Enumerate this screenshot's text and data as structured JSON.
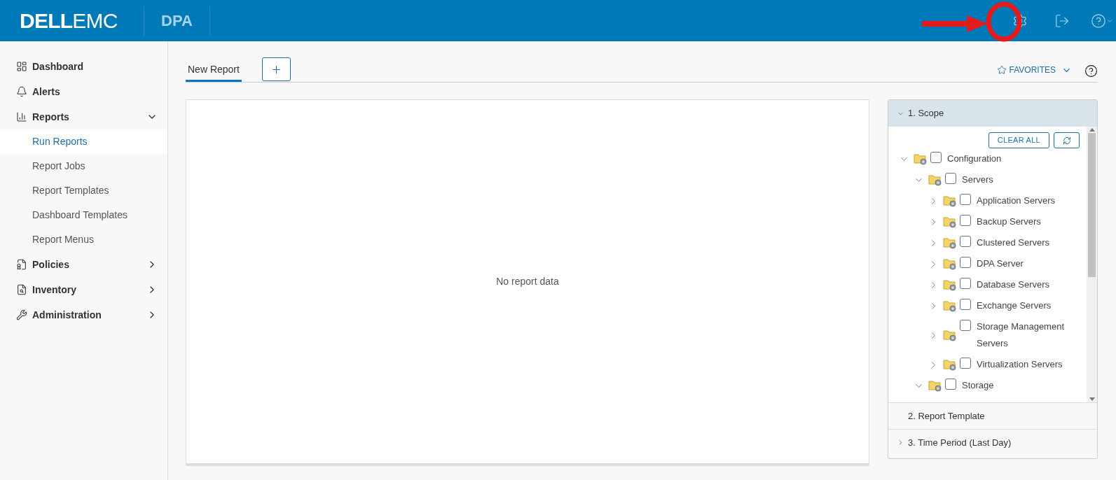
{
  "header": {
    "logo": "**DELL**EMC",
    "product": "DPA"
  },
  "sidebar": {
    "items": [
      {
        "label": "Dashboard",
        "kind": "plain"
      },
      {
        "label": "Alerts",
        "kind": "plain"
      },
      {
        "label": "Reports",
        "kind": "group",
        "expanded": true,
        "children": [
          {
            "label": "Run Reports",
            "selected": true
          },
          {
            "label": "Report Jobs",
            "selected": false
          },
          {
            "label": "Report Templates",
            "selected": false
          },
          {
            "label": "Dashboard Templates",
            "selected": false
          },
          {
            "label": "Report Menus",
            "selected": false
          }
        ]
      },
      {
        "label": "Policies",
        "kind": "group",
        "expanded": false
      },
      {
        "label": "Inventory",
        "kind": "group",
        "expanded": false
      },
      {
        "label": "Administration",
        "kind": "group",
        "expanded": false
      }
    ]
  },
  "tabs": [
    {
      "label": "New Report",
      "selected": true
    }
  ],
  "favorites": "FAVORITES",
  "report": {
    "empty_text": "No report data"
  },
  "wizard": {
    "sections": [
      {
        "title": "1. Scope",
        "kind": "toggle",
        "expanded": true
      },
      {
        "title": "2. Report Template",
        "kind": "plain",
        "expanded": false
      },
      {
        "title": "3. Time Period (Last Day)",
        "kind": "toggle",
        "expanded": false
      }
    ],
    "clear_all": "CLEAR ALL",
    "tree": [
      {
        "label": "Configuration",
        "expanded": true,
        "checked": false,
        "children": [
          {
            "label": "Servers",
            "expanded": true,
            "checked": false,
            "children": [
              {
                "label": "Application Servers",
                "expanded": false,
                "checked": false
              },
              {
                "label": "Backup Servers",
                "expanded": false,
                "checked": false
              },
              {
                "label": "Clustered Servers",
                "expanded": false,
                "checked": false
              },
              {
                "label": "DPA Server",
                "expanded": false,
                "checked": false
              },
              {
                "label": "Database Servers",
                "expanded": false,
                "checked": false
              },
              {
                "label": "Exchange Servers",
                "expanded": false,
                "checked": false
              },
              {
                "label": "Storage Management Servers",
                "expanded": false,
                "checked": false
              },
              {
                "label": "Virtualization Servers",
                "expanded": false,
                "checked": false
              }
            ]
          },
          {
            "label": "Storage",
            "expanded": true,
            "checked": false
          }
        ]
      }
    ]
  }
}
